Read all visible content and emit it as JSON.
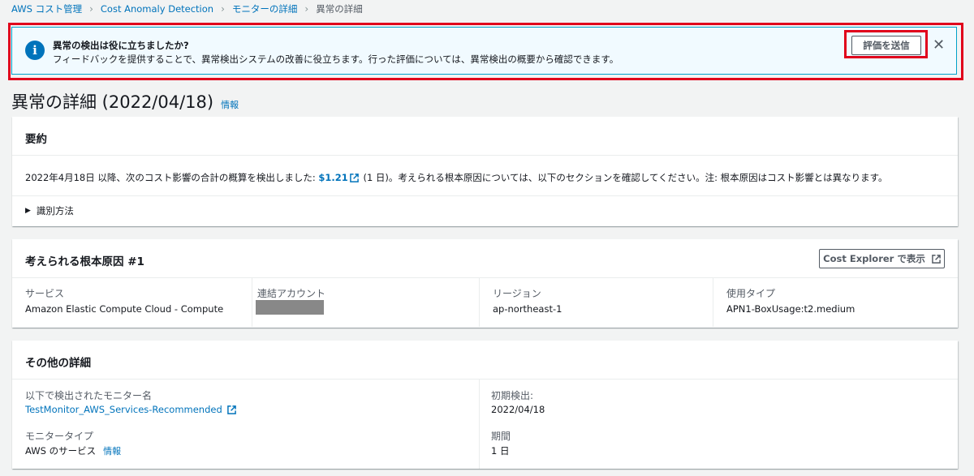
{
  "breadcrumb": [
    {
      "label": "AWS コスト管理"
    },
    {
      "label": "Cost Anomaly Detection"
    },
    {
      "label": "モニターの詳細"
    },
    {
      "label": "異常の詳細"
    }
  ],
  "flash": {
    "header": "異常の検出は役に立ちましたか?",
    "content": "フィードバックを提供することで、異常検出システムの改善に役立ちます。行った評価については、異常検出の概要から確認できます。",
    "button_label": "評価を送信",
    "close_glyph": "✕",
    "info_glyph": "i"
  },
  "page": {
    "title": "異常の詳細 (2022/04/18)",
    "info_link": "情報"
  },
  "summary": {
    "title": "要約",
    "text_before": "2022年4月18日 以降、次のコスト影響の合計の概算を検出しました: ",
    "amount": "$1.21",
    "text_after": " (1 日)。考えられる根本原因については、以下のセクションを確認してください。注: 根本原因はコスト影響とは異なります。",
    "expander_caret": "▶",
    "expander_label": "識別方法"
  },
  "root_cause": {
    "title": "考えられる根本原因 #1",
    "button_label": "Cost Explorer で表示",
    "columns": [
      {
        "label": "サービス",
        "value": "Amazon Elastic Compute Cloud - Compute"
      },
      {
        "label": "連結アカウント",
        "value": ""
      },
      {
        "label": "リージョン",
        "value": "ap-northeast-1"
      },
      {
        "label": "使用タイプ",
        "value": "APN1-BoxUsage:t2.medium"
      }
    ]
  },
  "details": {
    "title": "その他の詳細",
    "monitor_name_label": "以下で検出されたモニター名",
    "monitor_name_value": "TestMonitor_AWS_Services-Recommended",
    "monitor_type_label": "モニタータイプ",
    "monitor_type_value": "AWS のサービス",
    "monitor_type_info": "情報",
    "first_detected_label": "初期検出:",
    "first_detected_value": "2022/04/18",
    "duration_label": "期間",
    "duration_value": "1 日"
  },
  "colors": {
    "link": "#0073bb",
    "highlight": "#e0001b",
    "flash_bg": "#f1faff",
    "flash_border": "#00a1c9"
  }
}
